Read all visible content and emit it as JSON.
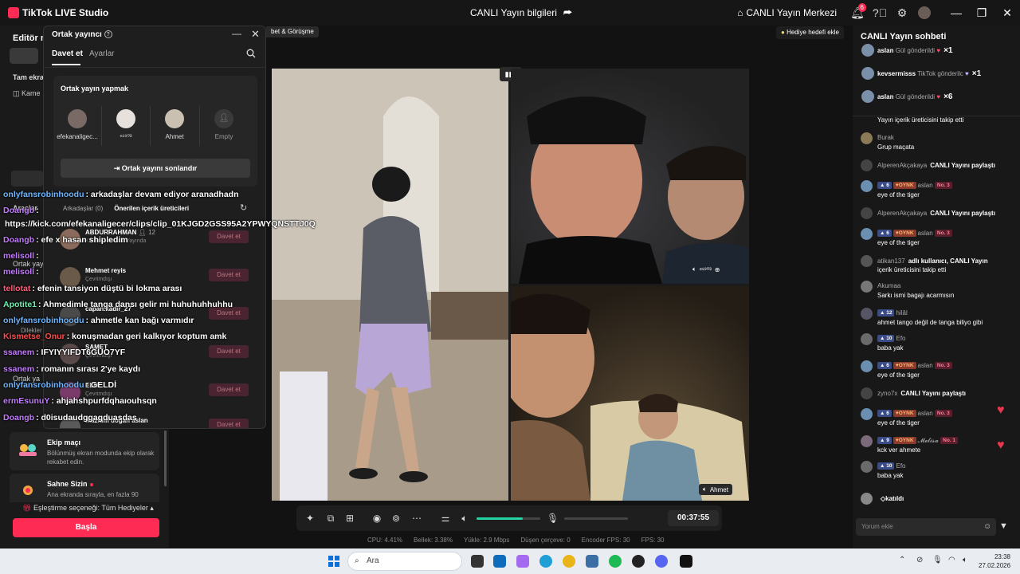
{
  "app": {
    "title": "TikTok LIVE Studio",
    "center_title": "CANLI Yayın bilgileri",
    "live_center": "CANLI Yayın Merkezi",
    "notification_count": "6"
  },
  "left_panel": {
    "editor_label": "Editör m",
    "tam_ekran": "Tam ekra",
    "kamera": "Kame",
    "araclar": "Araçlar",
    "ortak_yayin_1": "Ortak yayı",
    "dilekler": "Dilekler",
    "ortak_yayin_2": "Ortak ya",
    "cards": [
      {
        "title": "Ekip maçı",
        "desc": "Bölünmüş ekran modunda ekip olarak rekabet edin."
      },
      {
        "title": "Sahne Sizin",
        "desc": "Ana ekranda sırayla, en fazla 90"
      }
    ],
    "matching_option": "Eşleştirme seçeneği: Tüm Hediyeler",
    "start_button": "Başla"
  },
  "cohost_popup": {
    "title": "Ortak yayıncı",
    "tabs": [
      "Davet et",
      "Ayarlar"
    ],
    "section_title": "Ortak yayın yapmak",
    "hosts": [
      {
        "name": "efekanaligec...",
        "color": "#7a6a66"
      },
      {
        "name": "ᵉ¹⁹⁰³",
        "color": "#e6e1dc"
      },
      {
        "name": "Ahmet",
        "color": "#c9c0b2"
      },
      {
        "name": "Empty",
        "color": "#3a3a3a"
      }
    ],
    "end_button": "Ortak yayını sonlandır",
    "list_tabs": [
      "Arkadaşlar (0)",
      "Önerilen içerik üreticileri"
    ],
    "invite_label": "Davet et",
    "suggestions": [
      {
        "name": "ABDURRAHMAN",
        "sub": "Kullanıcı CANLI Yayında",
        "viewers": "12"
      },
      {
        "name": "Mehmet reyis",
        "sub": "Çevrimdışı"
      },
      {
        "name": "capan.kadir_27",
        "sub": ""
      },
      {
        "name": "SAMET",
        "sub": "Çevrimdışı"
      },
      {
        "name": "ELDI",
        "sub": "Çevrimdışı"
      },
      {
        "name": "mazlum doğan aslan",
        "sub": ""
      }
    ]
  },
  "overlay_chat": [
    {
      "user": "onlyfansrobinhoodu",
      "text": ": arkadaşlar devam ediyor aranadhadn",
      "color": "#6fb6ff"
    },
    {
      "user": "Doangb",
      "text": ":",
      "color": "#c37cff"
    },
    {
      "user": "",
      "text": "https://kick.com/efekanaligecer/clips/clip_01KJGD2GSS95A2YPWYQNSTTJ0Q",
      "color": "#ffffff"
    },
    {
      "user": "Doangb",
      "text": ": efe x hasan shipledim",
      "color": "#c37cff"
    },
    {
      "user": "melisoll",
      "text": ":",
      "color": "#c37cff"
    },
    {
      "user": "melisoll",
      "text": ":",
      "color": "#c37cff"
    },
    {
      "user": "tellotat",
      "text": ": efenin tansiyon düştü bi lokma arası",
      "color": "#ff5c7a"
    },
    {
      "user": "Apotite1",
      "text": ": Ahmedimle tanga dansı gelir mi huhuhuhhuhhu",
      "color": "#6ff0b0"
    },
    {
      "user": "onlyfansrobinhoodu",
      "text": ": ahmetle kan bağı varmıdır",
      "color": "#6fb6ff"
    },
    {
      "user": "Kismetse_Onur",
      "text": ": konuşmadan geri kalkıyor koptum amk",
      "color": "#ff4d4d"
    },
    {
      "user": "ssanem",
      "text": ": IFYIYYIFDT6GUO7YF",
      "color": "#c37cff"
    },
    {
      "user": "ssanem",
      "text": ": romanın sırası 2'ye kaydı",
      "color": "#c37cff"
    },
    {
      "user": "onlyfansrobinhoodu",
      "text": ": GELDİ",
      "color": "#6fb6ff"
    },
    {
      "user": "ermEsunuY",
      "text": ": ahjahshpurfdqhaıouhsqn",
      "color": "#c37cff"
    },
    {
      "user": "Doangb",
      "text": ": d0isudaudggagduasdas",
      "color": "#c37cff"
    }
  ],
  "stage": {
    "tag_left": "bet & Görüşme",
    "tag_right": "Hediye hedefi ekle",
    "labels": {
      "top_right": "ᵉ¹⁹⁰³",
      "bottom_right": "Ahmet"
    }
  },
  "controls": {
    "timer": "00:37:55",
    "volume_level": 0.72,
    "mic_level": 0
  },
  "stats": [
    {
      "label": "CPU:",
      "value": "4.41%"
    },
    {
      "label": "Bellek:",
      "value": "3.38%"
    },
    {
      "label": "Yükle:",
      "value": "2.9 Mbps"
    },
    {
      "label": "Düşen çerçeve:",
      "value": "0"
    },
    {
      "label": "Encoder FPS:",
      "value": "30"
    },
    {
      "label": "FPS:",
      "value": "30"
    }
  ],
  "chat": {
    "title": "CANLI Yayın sohbeti",
    "gifts": [
      {
        "user": "aslan",
        "text": "Gül gönderildi",
        "count": "×1",
        "color": "#ff4d6d"
      },
      {
        "user": "kevsermisss",
        "text": "TikTok gönderilc",
        "count": "×1",
        "color": "#c7b4ff"
      },
      {
        "user": "aslan",
        "text": "Gül gönderildi",
        "count": "×6",
        "color": "#ff4d6d"
      }
    ],
    "follow_cut": "Yayın içerik üreticisini takip etti",
    "messages": [
      {
        "user": "Burak",
        "text": "Grup maçata"
      },
      {
        "user": "AlperenAkçakaya",
        "share": "CANLI Yayını paylaştı"
      },
      {
        "user": "aslan",
        "lvl": "6",
        "fan": "OYNK",
        "no": "No. 3",
        "text": "eye of the tiger"
      },
      {
        "user": "AlperenAkçakaya",
        "share": "CANLI Yayını paylaştı"
      },
      {
        "user": "aslan",
        "lvl": "6",
        "fan": "OYNK",
        "no": "No. 3",
        "text": "eye of the tiger"
      },
      {
        "user": "atikan137",
        "share": "adlı kullanıcı, CANLI Yayın",
        "text": "içerik üreticisini takip etti"
      },
      {
        "user": "Akumaa",
        "text": "Sarkı ismi bagajı acarmısın"
      },
      {
        "user": "hilâl",
        "lvl": "12",
        "text": "ahmet tango değil de tanga biliyo gibi"
      },
      {
        "user": "Efo",
        "lvl": "10",
        "text": "baba yak"
      },
      {
        "user": "aslan",
        "lvl": "6",
        "fan": "OYNK",
        "no": "No. 3",
        "text": "eye of the tiger"
      },
      {
        "user": "zyno7x",
        "share": "CANLI Yayını paylaştı"
      },
      {
        "user": "aslan",
        "lvl": "6",
        "fan": "OYNK",
        "no": "No. 3",
        "text": "eye of the tiger"
      },
      {
        "user": "𝓜𝓮𝓵𝓲𝓼𝓪",
        "lvl": "9",
        "fan": "OYNK",
        "no": "No. 1",
        "text": "kck ver ahmete"
      },
      {
        "user": "Efo",
        "lvl": "10",
        "text": "baba yak"
      },
      {
        "user": "",
        "share": "◇katıldı"
      }
    ],
    "input_placeholder": "Yorum ekle"
  },
  "taskbar": {
    "search_placeholder": "Ara",
    "time": "23:38",
    "date": "27.02.2026"
  }
}
